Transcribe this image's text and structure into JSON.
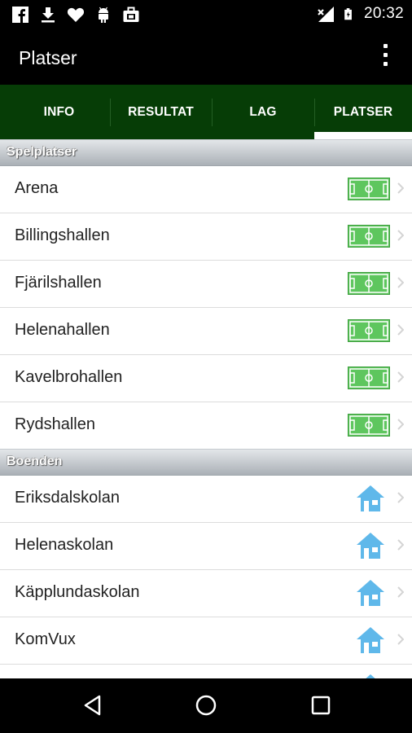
{
  "status_bar": {
    "time": "20:32",
    "left_icons": [
      "facebook-icon",
      "download-icon",
      "heart-icon",
      "android-icon",
      "briefcase-icon"
    ],
    "right_icons": [
      "signal-icon",
      "battery-icon"
    ]
  },
  "app_bar": {
    "title": "Platser"
  },
  "tabs": [
    {
      "label": "INFO"
    },
    {
      "label": "RESULTAT"
    },
    {
      "label": "LAG"
    },
    {
      "label": "PLATSER"
    }
  ],
  "selected_tab": "PLATSER",
  "sections": [
    {
      "title": "Spelplatser",
      "icon": "field-icon",
      "items": [
        "Arena",
        "Billingshallen",
        "Fjärilshallen",
        "Helenahallen",
        "Kavelbrohallen",
        "Rydshallen"
      ]
    },
    {
      "title": "Boenden",
      "icon": "house-icon",
      "items": [
        "Eriksdalskolan",
        "Helenaskolan",
        "Käpplundaskolan",
        "KomVux"
      ]
    }
  ],
  "colors": {
    "tab_bar": "#063d06",
    "field_green": "#5ec65e",
    "house_blue": "#5fb8ea"
  },
  "nav_bar": {
    "buttons": [
      "back-icon",
      "home-icon",
      "recents-icon"
    ]
  }
}
